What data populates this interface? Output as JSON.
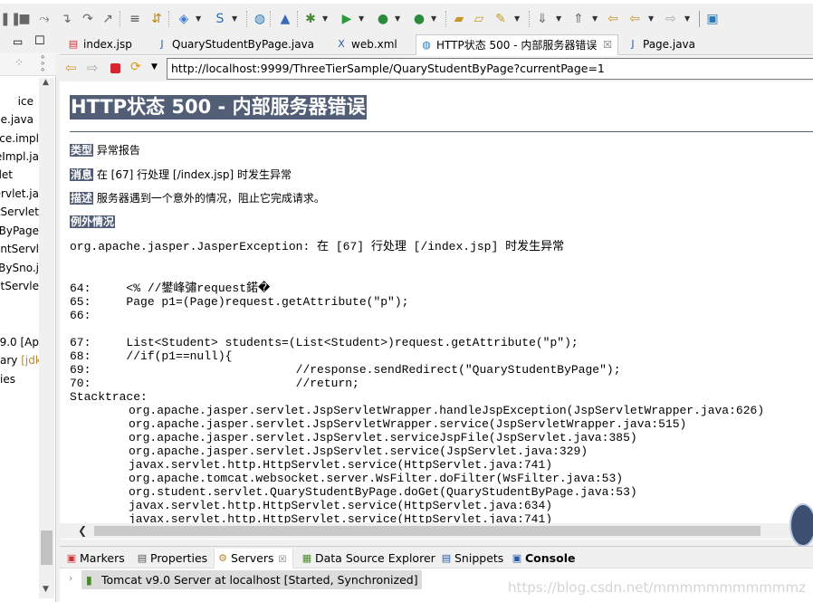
{
  "toolbar": {
    "icons": [
      "suspend-icon",
      "terminate-icon",
      "disconnect-icon",
      "step-into-icon",
      "step-over-icon",
      "step-return-icon",
      "drop-to-frame-icon",
      "use-step-filters-icon",
      "new-server-icon",
      "new-spring-icon",
      "globe-icon",
      "launch-icon",
      "debug-icon",
      "run-icon",
      "run-server-icon",
      "external-tools-icon",
      "open-type-icon",
      "open-task-icon",
      "search-icon",
      "next-annotation-icon",
      "prev-annotation-icon",
      "last-edit-icon",
      "back-icon",
      "forward-icon",
      "open-perspective-icon"
    ]
  },
  "left_panel": {
    "items": [
      "ice",
      "ce.java",
      "ice.impl",
      "eImpl.ja",
      "let",
      "ervlet.ja",
      "tServlet",
      "ByPage",
      "entServl",
      "BySno.j",
      "ntServle",
      "v9.0 [Ap",
      "ary",
      "[jdk-",
      "ies"
    ]
  },
  "editor": {
    "tabs": [
      {
        "label": "index.jsp",
        "icon": "jsp-file-icon"
      },
      {
        "label": "QuaryStudentByPage.java",
        "icon": "java-file-warning-icon"
      },
      {
        "label": "web.xml",
        "icon": "xml-file-icon"
      },
      {
        "label": "HTTP状态 500 - 内部服务器错误",
        "icon": "globe-icon",
        "active": true
      },
      {
        "label": "Page.java",
        "icon": "java-file-icon"
      }
    ],
    "url": "http://localhost:9999/ThreeTierSample/QuaryStudentByPage?currentPage=1"
  },
  "page": {
    "title": "HTTP状态 500 - 内部服务器错误",
    "type_label": "类型",
    "type_value": "异常报告",
    "message_label": "消息",
    "message_value": "在 [67] 行处理 [/index.jsp] 时发生异常",
    "desc_label": "描述",
    "desc_value": "服务器遇到一个意外的情况，阻止它完成请求。",
    "exception_label": "例外情况",
    "exception": "org.apache.jasper.JasperException: 在 [67] 行处理 [/index.jsp] 时发生异常",
    "code_lines": [
      "64:     <% //鐢峰彇request鍩�",
      "65:     Page p1=(Page)request.getAttribute(\"p\");",
      "66:",
      "67:     List<Student> students=(List<Student>)request.getAttribute(\"p\");",
      "68:     //if(p1==null){",
      "69:                             //response.sendRedirect(\"QuaryStudentByPage\");",
      "70:                             //return;"
    ],
    "stacktrace_label": "Stacktrace:",
    "stacktrace": [
      "org.apache.jasper.servlet.JspServletWrapper.handleJspException(JspServletWrapper.java:626)",
      "org.apache.jasper.servlet.JspServletWrapper.service(JspServletWrapper.java:515)",
      "org.apache.jasper.servlet.JspServlet.serviceJspFile(JspServlet.java:385)",
      "org.apache.jasper.servlet.JspServlet.service(JspServlet.java:329)",
      "javax.servlet.http.HttpServlet.service(HttpServlet.java:741)",
      "org.apache.tomcat.websocket.server.WsFilter.doFilter(WsFilter.java:53)",
      "org.student.servlet.QuaryStudentByPage.doGet(QuaryStudentByPage.java:53)",
      "javax.servlet.http.HttpServlet.service(HttpServlet.java:634)",
      "javax.servlet.http.HttpServlet.service(HttpServlet.java:741)"
    ]
  },
  "bottom": {
    "tabs": [
      {
        "label": "Markers",
        "icon": "markers-icon"
      },
      {
        "label": "Properties",
        "icon": "properties-icon"
      },
      {
        "label": "Servers",
        "icon": "servers-icon",
        "active": true
      },
      {
        "label": "Data Source Explorer",
        "icon": "data-source-icon"
      },
      {
        "label": "Snippets",
        "icon": "snippets-icon"
      },
      {
        "label": "Console",
        "icon": "console-icon"
      }
    ],
    "server": "Tomcat v9.0 Server at localhost  [Started, Synchronized]"
  },
  "watermark": "https://blog.csdn.net/mmmmmmmmmmmz",
  "colors": {
    "header_bg": "#525d76",
    "stop_red": "#d9232e",
    "jdk_label": "#b58a3c"
  }
}
